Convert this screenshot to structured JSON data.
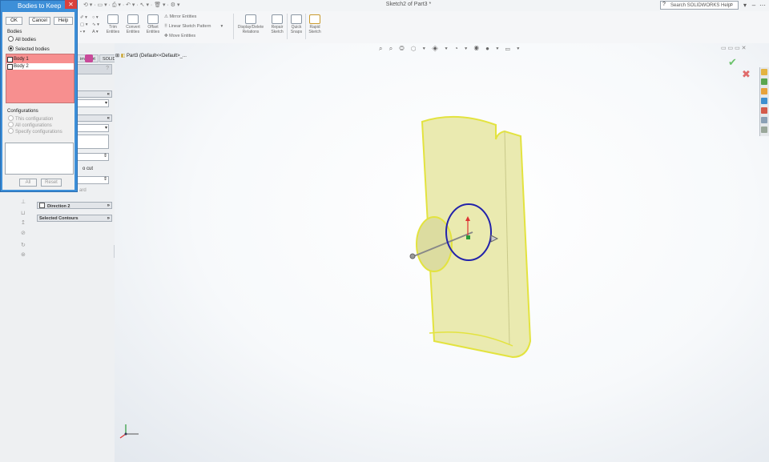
{
  "window": {
    "title": "Sketch2 of Part3 *",
    "search_placeholder": "Search SOLIDWORKS Help"
  },
  "ribbon": {
    "trim": "Trim\nEntities",
    "convert": "Convert\nEntities",
    "offset": "Offset\nEntities",
    "mirror": "Mirror Entities",
    "linear_pattern": "Linear Sketch Pattern",
    "move": "Move Entities",
    "display_delete": "Display/Delete\nRelations",
    "repair": "Repair\nSketch",
    "quick_snaps": "Quick\nSnaps",
    "rapid": "Rapid\nSketch"
  },
  "fm_tabs": {
    "simxpert": "imXpert",
    "addins": "SOLIDWORKS Add-Ins"
  },
  "fm_groups": {
    "direction2": "Direction 2",
    "contours": "Selected Contours",
    "partial_cut": "o cut",
    "partial_ward": "ard"
  },
  "tree": {
    "root": "Part3 (Default<<Default>_..."
  },
  "dialog": {
    "title": "Bodies to Keep",
    "ok": "OK",
    "cancel": "Cancel",
    "help": "Help",
    "bodies_label": "Bodies",
    "all_bodies": "All bodies",
    "selected_bodies": "Selected bodies",
    "bodies": [
      "Body 1",
      "Body 2"
    ],
    "configurations_label": "Configurations",
    "this_config": "This configuration",
    "all_configs": "All configurations",
    "specify_configs": "Specify configurations",
    "all_btn": "All",
    "reset_btn": "Reset"
  },
  "colors": {
    "accent": "#3d8fd8",
    "body_list": "#f78f8f",
    "model": "#e6e6a2",
    "sketch_circle": "#2222aa"
  }
}
